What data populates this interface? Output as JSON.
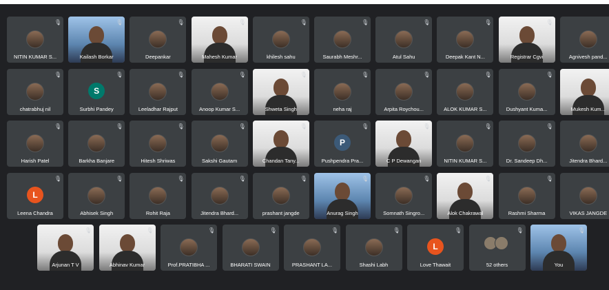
{
  "meeting": {
    "others_label": "52 others",
    "others_count": 52
  },
  "colors": {
    "background": "#202124",
    "tile": "#3c4043",
    "avatar_s": "#00796b",
    "avatar_p": "#3c5a78",
    "avatar_l": "#e8541e"
  },
  "participants": [
    {
      "name": "NITIN KUMAR S...",
      "type": "avatar"
    },
    {
      "name": "Kailash Borkar",
      "type": "video",
      "tone": "blue"
    },
    {
      "name": "Deepankar",
      "type": "avatar"
    },
    {
      "name": "Mahesh Kumar",
      "type": "video",
      "tone": "white"
    },
    {
      "name": "khilesh sahu",
      "type": "avatar"
    },
    {
      "name": "Saurabh Meshr...",
      "type": "avatar"
    },
    {
      "name": "Atul Sahu",
      "type": "avatar"
    },
    {
      "name": "Deepak Kant N...",
      "type": "avatar"
    },
    {
      "name": "Registrar Cgvi",
      "type": "video",
      "tone": "white"
    },
    {
      "name": "Agnivesh pand...",
      "type": "avatar"
    },
    {
      "name": "chatrabhuj nil",
      "type": "avatar"
    },
    {
      "name": "Surbhi Pandey",
      "type": "letter",
      "letter": "S",
      "color": "#00796b"
    },
    {
      "name": "Leeladhar Rajput",
      "type": "avatar"
    },
    {
      "name": "Anoop Kumar S...",
      "type": "avatar"
    },
    {
      "name": "Shweta Singh",
      "type": "video",
      "tone": "white"
    },
    {
      "name": "neha raj",
      "type": "avatar"
    },
    {
      "name": "Arpita Roychou...",
      "type": "avatar"
    },
    {
      "name": "ALOK KUMAR S...",
      "type": "avatar"
    },
    {
      "name": "Dushyant Kuma...",
      "type": "avatar"
    },
    {
      "name": "Mukesh Kum...",
      "type": "video",
      "tone": "white"
    },
    {
      "name": "Harish Patel",
      "type": "avatar"
    },
    {
      "name": "Barkha Banjare",
      "type": "avatar"
    },
    {
      "name": "Hitesh Shriwas",
      "type": "avatar"
    },
    {
      "name": "Sakshi Gautam",
      "type": "avatar"
    },
    {
      "name": "Chandan Tany...",
      "type": "video",
      "tone": "white"
    },
    {
      "name": "Pushpendra Pra...",
      "type": "letter",
      "letter": "P",
      "color": "#3c5a78"
    },
    {
      "name": "C P Dewangan",
      "type": "video",
      "tone": "white"
    },
    {
      "name": "NITIN KUMAR S...",
      "type": "avatar"
    },
    {
      "name": "Dr. Sandeep Dh...",
      "type": "avatar"
    },
    {
      "name": "Jitendra Bhard...",
      "type": "avatar"
    },
    {
      "name": "Leena Chandra",
      "type": "letter",
      "letter": "L",
      "color": "#e8541e"
    },
    {
      "name": "Abhisek Singh",
      "type": "avatar"
    },
    {
      "name": "Rohit Raja",
      "type": "avatar"
    },
    {
      "name": "Jitendra Bhard...",
      "type": "avatar"
    },
    {
      "name": "prashant jangde",
      "type": "avatar"
    },
    {
      "name": "Anurag Singh",
      "type": "video",
      "tone": "blue"
    },
    {
      "name": "Somnath Singro...",
      "type": "avatar"
    },
    {
      "name": "Alok Chakrawal",
      "type": "video",
      "tone": "white"
    },
    {
      "name": "Rashmi Sharma",
      "type": "avatar"
    },
    {
      "name": "VIKAS JANGDE",
      "type": "avatar"
    },
    {
      "name": "Arjunan T V",
      "type": "video",
      "tone": "white"
    },
    {
      "name": "Abhinav Kumar",
      "type": "video",
      "tone": "white"
    },
    {
      "name": "Prof.PRATIBHA ...",
      "type": "avatar"
    },
    {
      "name": "BHARATI SWAIN",
      "type": "avatar"
    },
    {
      "name": "PRASHANT LA...",
      "type": "avatar"
    },
    {
      "name": "Shashi Labh",
      "type": "avatar"
    },
    {
      "name": "Love Thawait",
      "type": "letter",
      "letter": "L",
      "color": "#e8541e"
    },
    {
      "name": "52 others",
      "type": "others"
    },
    {
      "name": "You",
      "type": "video",
      "tone": "blue"
    }
  ]
}
